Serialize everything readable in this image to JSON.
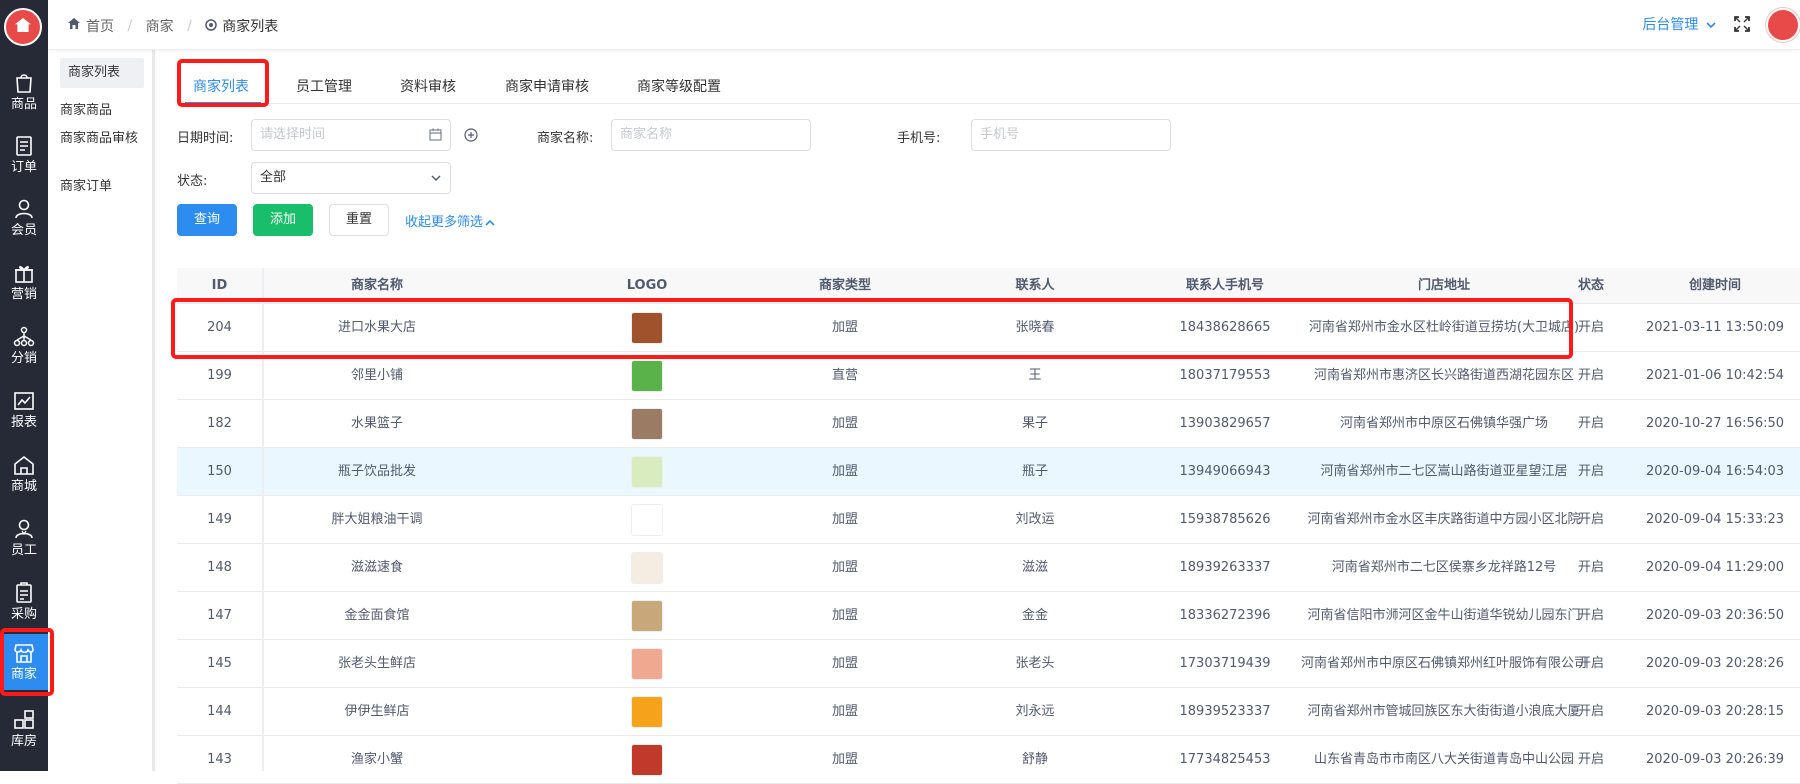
{
  "header": {
    "breadcrumb": [
      "首页",
      "商家",
      "商家列表"
    ],
    "admin_menu": "后台管理"
  },
  "rail": {
    "items": [
      {
        "label": "商品",
        "icon": "bag-icon"
      },
      {
        "label": "订单",
        "icon": "order-icon"
      },
      {
        "label": "会员",
        "icon": "user-icon"
      },
      {
        "label": "营销",
        "icon": "gift-icon"
      },
      {
        "label": "分销",
        "icon": "network-icon"
      },
      {
        "label": "报表",
        "icon": "chart-icon"
      },
      {
        "label": "商城",
        "icon": "house-icon"
      },
      {
        "label": "员工",
        "icon": "staff-icon"
      },
      {
        "label": "采购",
        "icon": "clipboard-icon"
      },
      {
        "label": "商家",
        "icon": "store-icon"
      },
      {
        "label": "库房",
        "icon": "warehouse-icon"
      }
    ],
    "active_label": "商家"
  },
  "submenu": {
    "items": [
      "商家列表",
      "商家商品",
      "商家商品审核",
      "商家订单"
    ]
  },
  "tabs": [
    "商家列表",
    "员工管理",
    "资料审核",
    "商家申请审核",
    "商家等级配置"
  ],
  "filters": {
    "date_label": "日期时间:",
    "date_placeholder": "请选择时间",
    "name_label": "商家名称:",
    "name_placeholder": "商家名称",
    "phone_label": "手机号:",
    "phone_placeholder": "手机号",
    "status_label": "状态:",
    "status_value": "全部"
  },
  "buttons": {
    "query": "查询",
    "add": "添加",
    "reset": "重置",
    "toggle_filters": "收起更多筛选"
  },
  "table": {
    "columns": [
      "ID",
      "商家名称",
      "LOGO",
      "商家类型",
      "联系人",
      "联系人手机号",
      "门店地址",
      "状态",
      "创建时间"
    ],
    "rows": [
      {
        "id": "204",
        "name": "进口水果大店",
        "type": "加盟",
        "contact": "张晓春",
        "phone": "18438628665",
        "address": "河南省郑州市金水区杜岭街道豆捞坊(大卫城店)",
        "status": "开启",
        "created": "2021-03-11 13:50:09",
        "logo_color": "#a0522d"
      },
      {
        "id": "199",
        "name": "邻里小铺",
        "type": "直营",
        "contact": "王",
        "phone": "18037179553",
        "address": "河南省郑州市惠济区长兴路街道西湖花园东区",
        "status": "开启",
        "created": "2021-01-06 10:42:54",
        "logo_color": "#5ab34a"
      },
      {
        "id": "182",
        "name": "水果篮子",
        "type": "加盟",
        "contact": "果子",
        "phone": "13903829657",
        "address": "河南省郑州市中原区石佛镇华强广场",
        "status": "开启",
        "created": "2020-10-27 16:56:50",
        "logo_color": "#9c7b64"
      },
      {
        "id": "150",
        "name": "瓶子饮品批发",
        "type": "加盟",
        "contact": "瓶子",
        "phone": "13949066943",
        "address": "河南省郑州市二七区嵩山路街道亚星望江居",
        "status": "开启",
        "created": "2020-09-04 16:54:03",
        "logo_color": "#d9ecc0"
      },
      {
        "id": "149",
        "name": "胖大姐粮油干调",
        "type": "加盟",
        "contact": "刘改运",
        "phone": "15938785626",
        "address": "河南省郑州市金水区丰庆路街道中方园小区北院",
        "status": "开启",
        "created": "2020-09-04 15:33:23",
        "logo_color": "#ffffff"
      },
      {
        "id": "148",
        "name": "滋滋速食",
        "type": "加盟",
        "contact": "滋滋",
        "phone": "18939263337",
        "address": "河南省郑州市二七区侯寨乡龙祥路12号",
        "status": "开启",
        "created": "2020-09-04 11:29:00",
        "logo_color": "#f5ece2"
      },
      {
        "id": "147",
        "name": "金金面食馆",
        "type": "加盟",
        "contact": "金金",
        "phone": "18336272396",
        "address": "河南省信阳市浉河区金牛山街道华锐幼儿园东门",
        "status": "开启",
        "created": "2020-09-03 20:36:50",
        "logo_color": "#c8a77b"
      },
      {
        "id": "145",
        "name": "张老头生鲜店",
        "type": "加盟",
        "contact": "张老头",
        "phone": "17303719439",
        "address": "河南省郑州市中原区石佛镇郑州红叶服饰有限公司",
        "status": "开启",
        "created": "2020-09-03 20:28:26",
        "logo_color": "#f0a890"
      },
      {
        "id": "144",
        "name": "伊伊生鲜店",
        "type": "加盟",
        "contact": "刘永远",
        "phone": "18939523337",
        "address": "河南省郑州市管城回族区东大街街道小浪底大厦",
        "status": "开启",
        "created": "2020-09-03 20:28:15",
        "logo_color": "#f7a21b"
      },
      {
        "id": "143",
        "name": "渔家小蟹",
        "type": "加盟",
        "contact": "舒静",
        "phone": "17734825453",
        "address": "山东省青岛市市南区八大关街道青岛中山公园",
        "status": "开启",
        "created": "2020-09-03 20:26:39",
        "logo_color": "#c0392b"
      }
    ]
  }
}
